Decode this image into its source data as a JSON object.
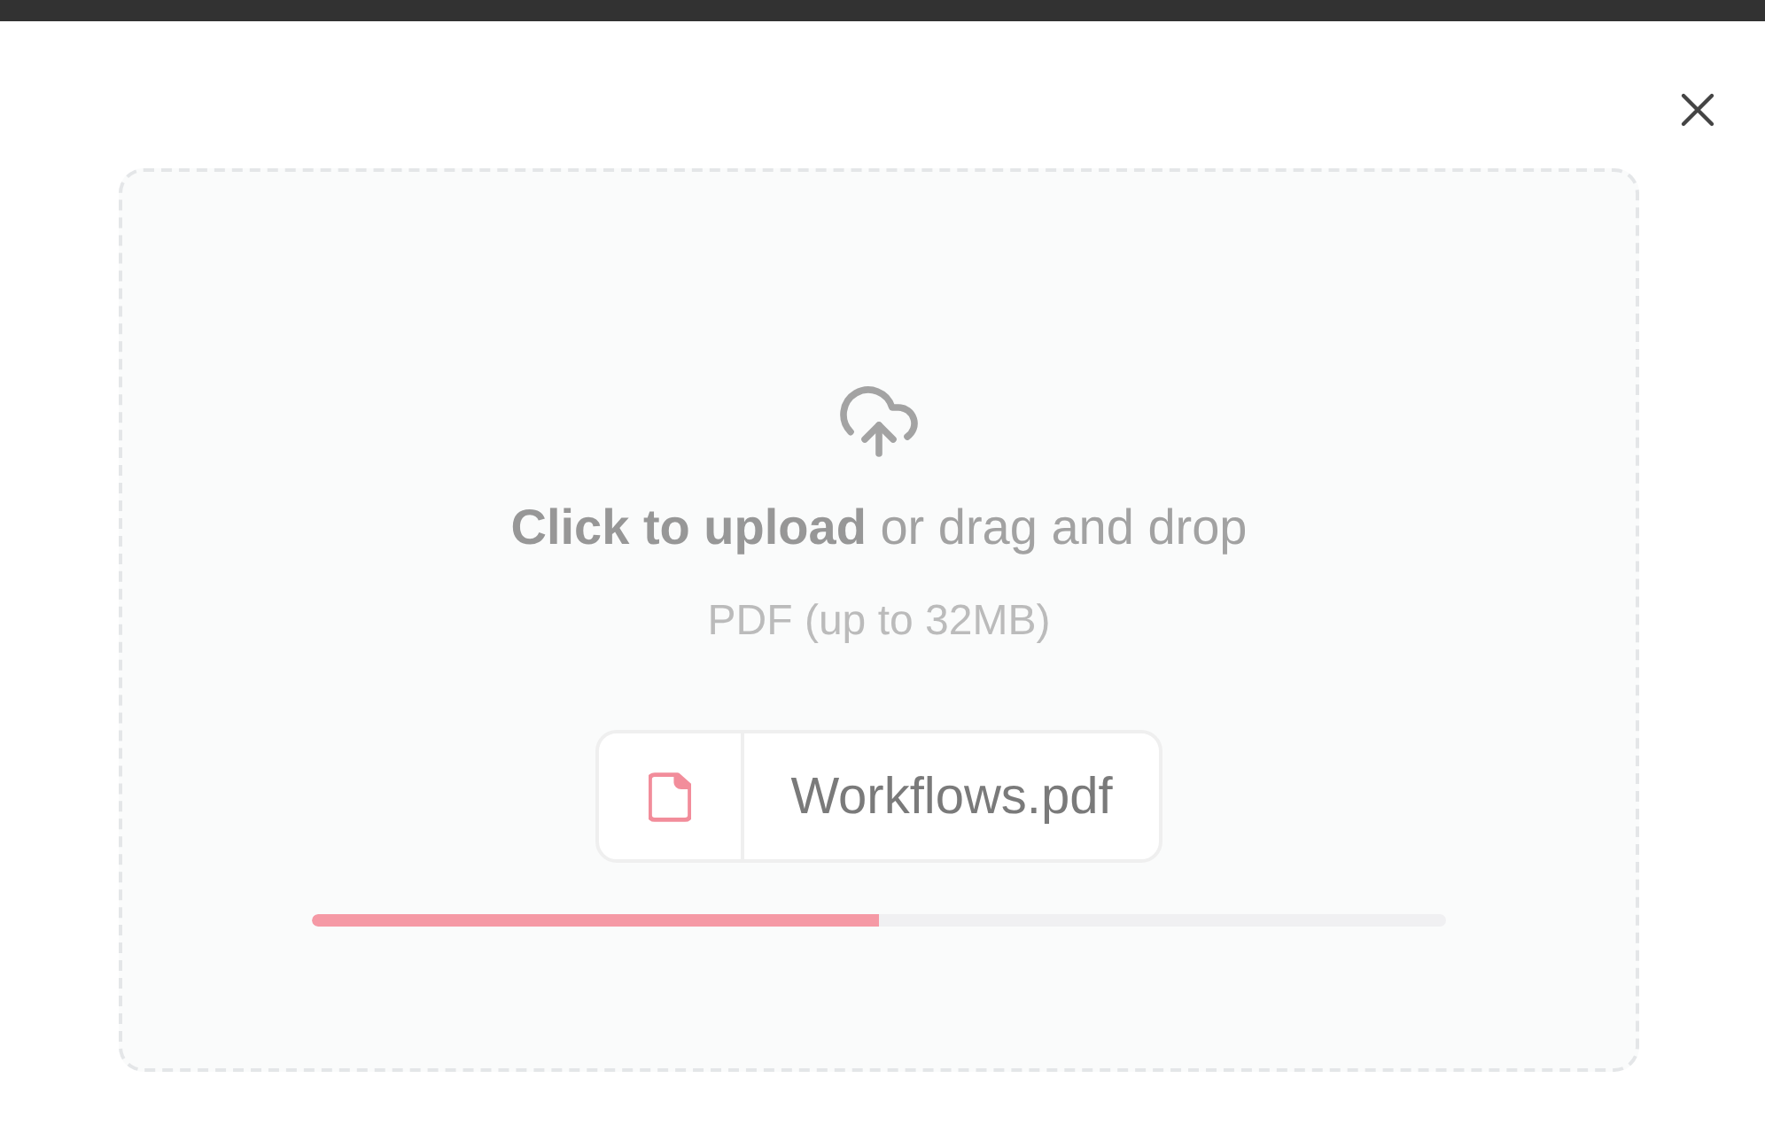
{
  "dropzone": {
    "prompt": "**Click to upload** or drag and drop",
    "hint": "PDF (up to 32MB)",
    "file": {
      "name": "Workflows.pdf"
    },
    "upload_progress": {
      "level": 0.5
    }
  }
}
